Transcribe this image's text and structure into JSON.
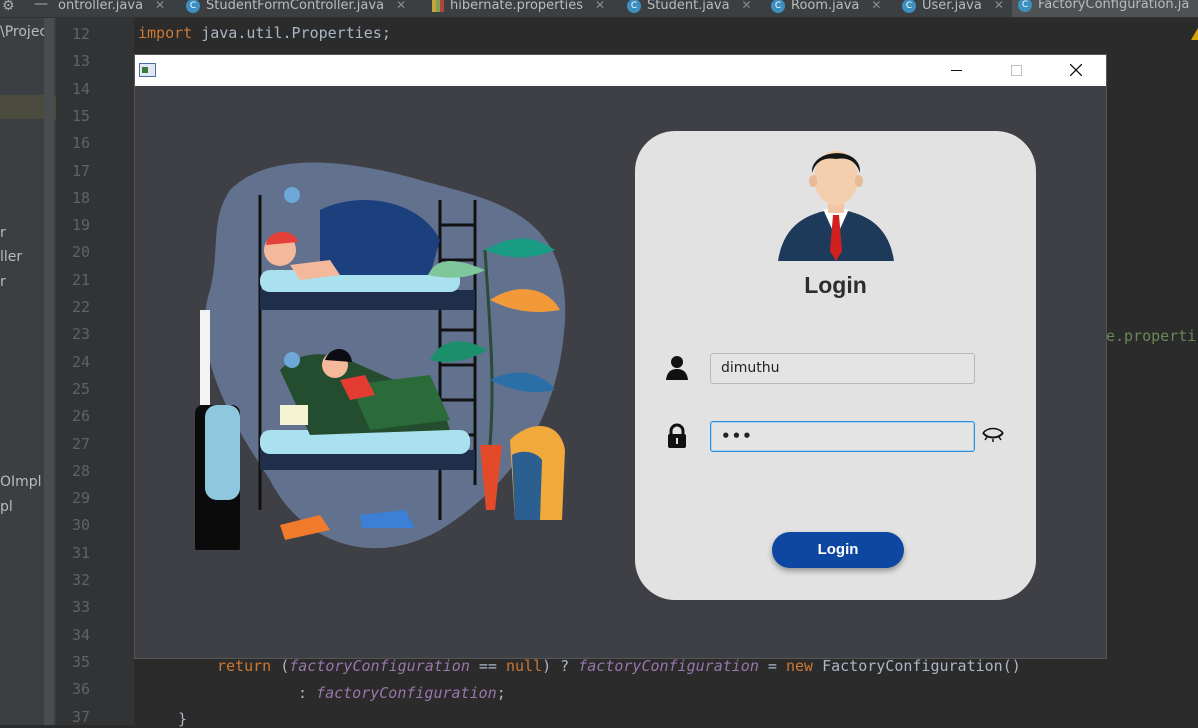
{
  "ide": {
    "tabs": [
      {
        "label": "ontroller.java",
        "icon": "class-icon"
      },
      {
        "label": "StudentFormController.java",
        "icon": "class-icon"
      },
      {
        "label": "hibernate.properties",
        "icon": "properties-icon"
      },
      {
        "label": "Student.java",
        "icon": "class-icon"
      },
      {
        "label": "Room.java",
        "icon": "class-icon"
      },
      {
        "label": "User.java",
        "icon": "class-icon"
      },
      {
        "label": "FactoryConfiguration.ja",
        "icon": "class-icon"
      }
    ],
    "project_panel": {
      "path": "\\Project",
      "items": [
        "r",
        "ller",
        "r",
        "OImpl",
        "pl"
      ]
    },
    "line_numbers": [
      "12",
      "13",
      "14",
      "15",
      "16",
      "17",
      "18",
      "19",
      "20",
      "21",
      "22",
      "23",
      "24",
      "25",
      "26",
      "27",
      "28",
      "29",
      "30",
      "31",
      "32",
      "33",
      "34",
      "35",
      "36",
      "37"
    ],
    "code": {
      "line12_kw": "import",
      "line12_rest": " java.util.Properties;",
      "line23_fragment": "e.properti",
      "line35_kw1": "return",
      "line35_p1": " (",
      "line35_it1": "factoryConfiguration",
      "line35_p2": " == ",
      "line35_kw2": "null",
      "line35_p3": ") ? ",
      "line35_it2": "factoryConfiguration",
      "line35_p4": " = ",
      "line35_kw3": "new",
      "line35_p5": " FactoryConfiguration()",
      "line36_p1": ": ",
      "line36_it": "factoryConfiguration",
      "line36_p2": ";",
      "line37": "}"
    }
  },
  "window": {
    "controls": {
      "minimize": "minimize-icon",
      "maximize": "maximize-icon",
      "close": "close-icon"
    }
  },
  "login": {
    "title": "Login",
    "username_value": "dimuthu",
    "password_masked": "•••",
    "button_label": "Login"
  },
  "colors": {
    "window_bg": "#3f3f46",
    "card_bg": "#e2e2e2",
    "button_bg": "#0d47a1",
    "focus_border": "#2e8fd6"
  }
}
